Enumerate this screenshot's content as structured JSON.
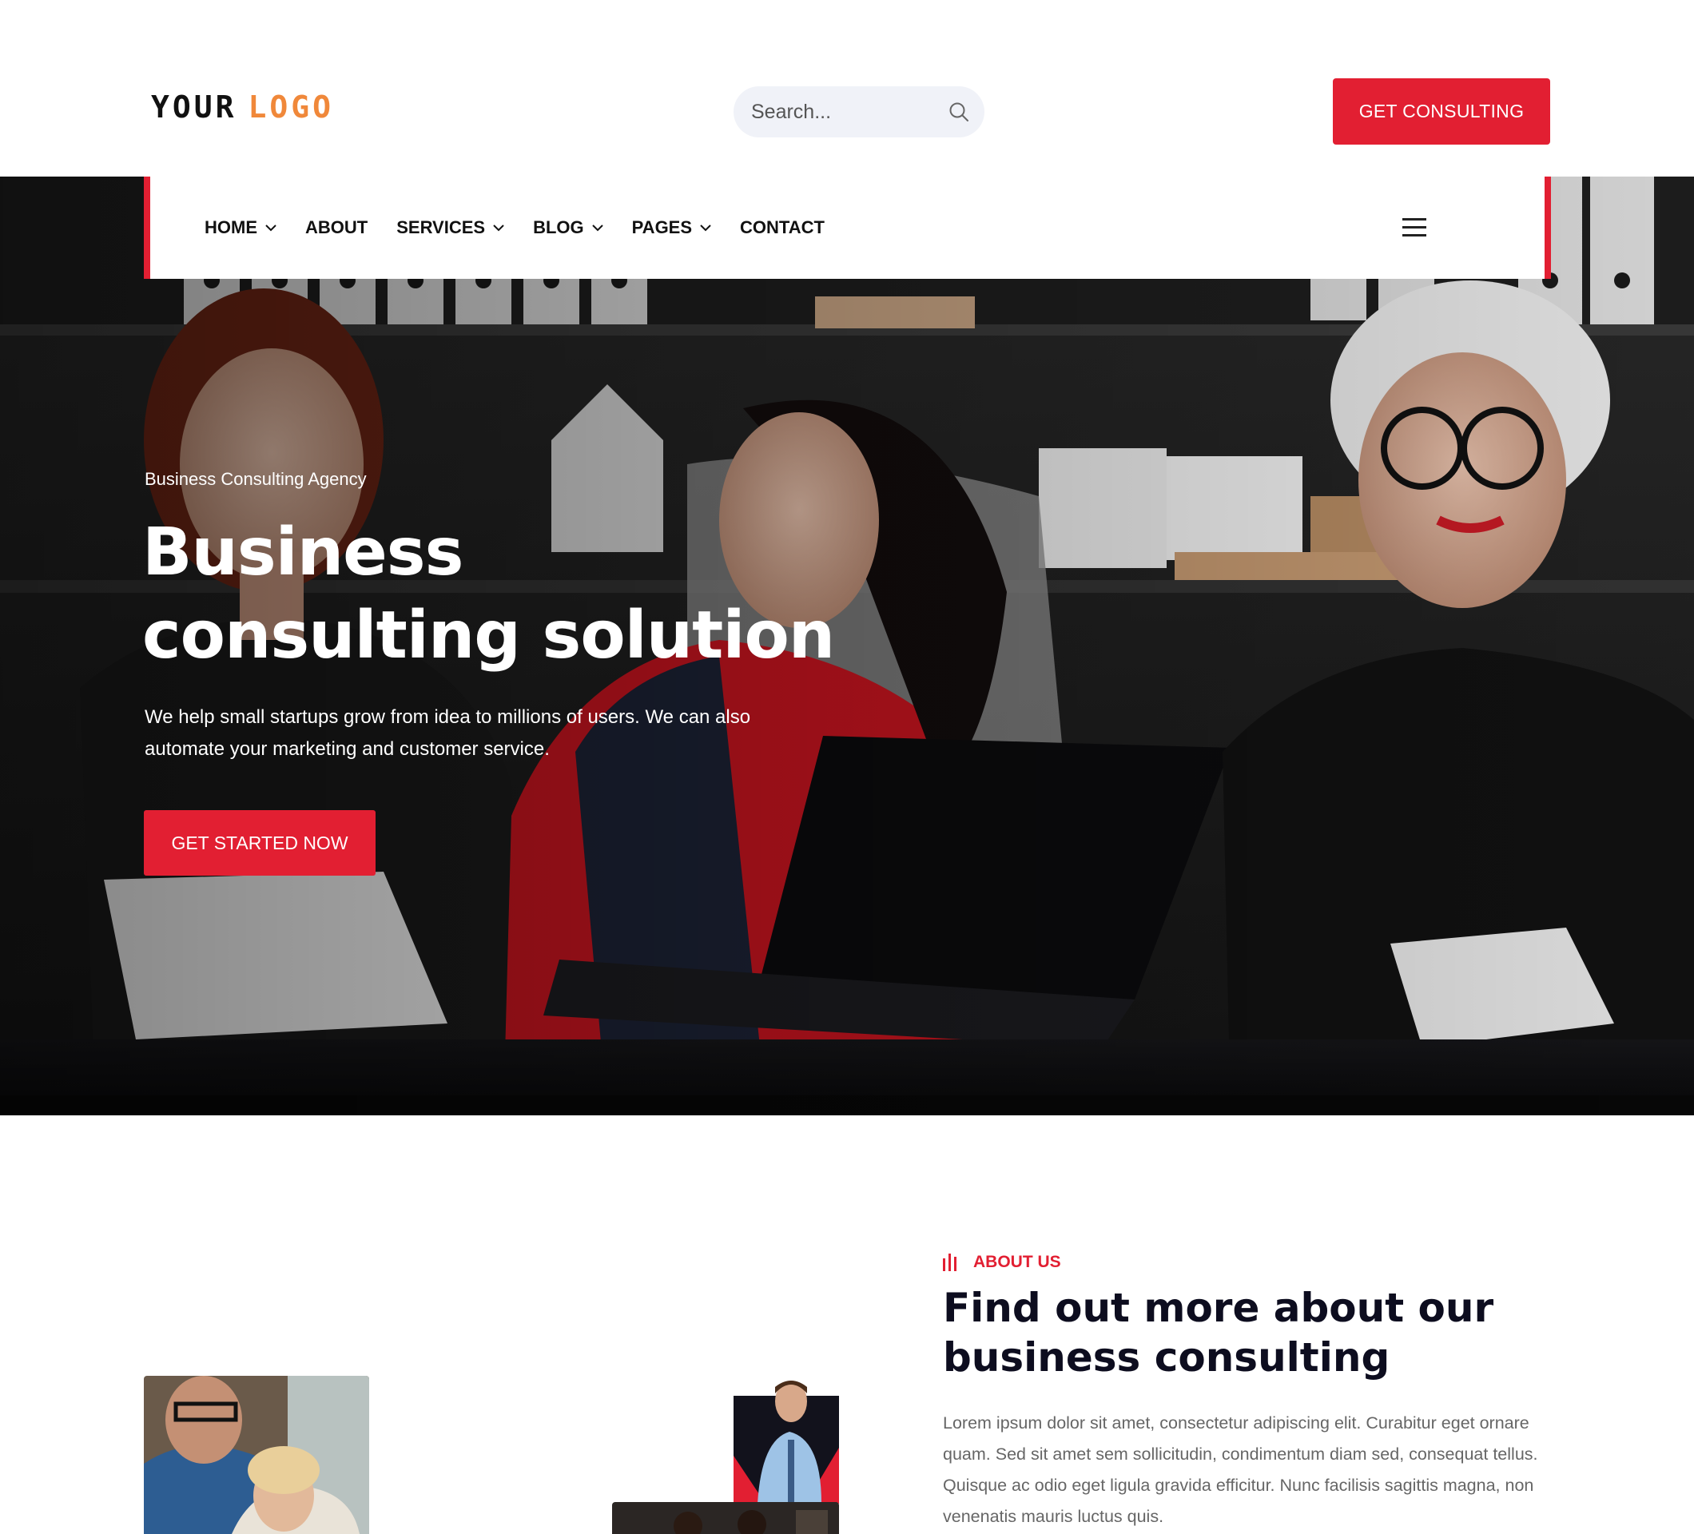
{
  "header": {
    "logo": {
      "word1": "YOUR",
      "word2": "LOGO"
    },
    "search": {
      "placeholder": "Search..."
    },
    "cta_label": "GET CONSULTING"
  },
  "nav": {
    "items": [
      {
        "label": "HOME",
        "has_dropdown": true
      },
      {
        "label": "ABOUT",
        "has_dropdown": false
      },
      {
        "label": "SERVICES",
        "has_dropdown": true
      },
      {
        "label": "BLOG",
        "has_dropdown": true
      },
      {
        "label": "PAGES",
        "has_dropdown": true
      },
      {
        "label": "CONTACT",
        "has_dropdown": false
      }
    ],
    "menu_icon": "hamburger-icon"
  },
  "hero": {
    "eyebrow": "Business Consulting Agency",
    "title": "Business consulting solution",
    "subtitle": "We help small startups grow from idea to millions of users. We can also automate your marketing and customer service.",
    "cta_label": "GET STARTED NOW"
  },
  "about": {
    "eyebrow": "ABOUT US",
    "title": "Find out more about our business consulting",
    "text": "Lorem ipsum dolor sit amet, consectetur adipiscing elit. Curabitur eget ornare quam. Sed sit amet sem sollicitudin, condimentum diam sed, consequat tellus. Quisque ac odio eget ligula gravida efficitur. Nunc facilisis sagittis magna, non venenatis mauris luctus quis."
  },
  "colors": {
    "accent": "#e21f32",
    "logo_accent": "#f0883a",
    "heading": "#0d0d1f",
    "body_text": "#666666"
  },
  "icons": {
    "search": "search-icon",
    "dropdown": "chevron-down-icon",
    "eyebrow": "bars-icon"
  }
}
